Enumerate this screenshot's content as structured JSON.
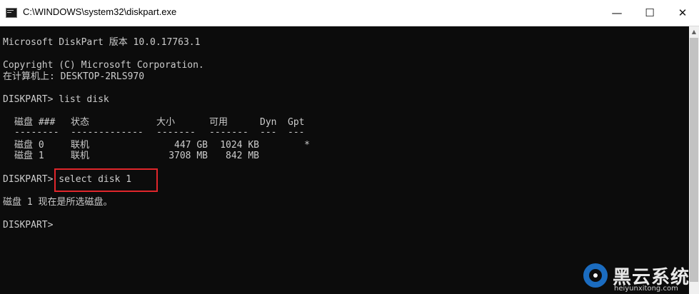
{
  "window": {
    "title": "C:\\WINDOWS\\system32\\diskpart.exe",
    "minimize_glyph": "—",
    "maximize_glyph": "☐",
    "close_glyph": "✕",
    "app_icon": "console-app-icon"
  },
  "console": {
    "banner": "Microsoft DiskPart 版本 10.0.17763.1",
    "copyright": "Copyright (C) Microsoft Corporation.",
    "computer": "在计算机上: DESKTOP-2RLS970",
    "cmd1_prompt": "DISKPART> ",
    "cmd1_text": "list disk",
    "table": {
      "headers": [
        "磁盘 ###",
        "状态",
        "大小",
        "可用",
        "Dyn",
        "Gpt"
      ],
      "separators": [
        "--------",
        "-------------",
        "-------",
        "-------",
        "---",
        "---"
      ],
      "rows": [
        [
          "磁盘 0",
          "联机",
          "447 GB",
          "1024 KB",
          "",
          "*"
        ],
        [
          "磁盘 1",
          "联机",
          "3708 MB",
          "842 MB",
          "",
          ""
        ]
      ]
    },
    "cmd2_prompt": "DISKPART> ",
    "cmd2_text": "select disk 1",
    "result": "磁盘 1 现在是所选磁盘。",
    "final_prompt": "DISKPART>"
  },
  "highlight_color": "#e0262b",
  "watermark": {
    "text": "黑云系统",
    "url": "heiyunxitong.com",
    "logo_icon": "heiyun-logo-icon"
  }
}
